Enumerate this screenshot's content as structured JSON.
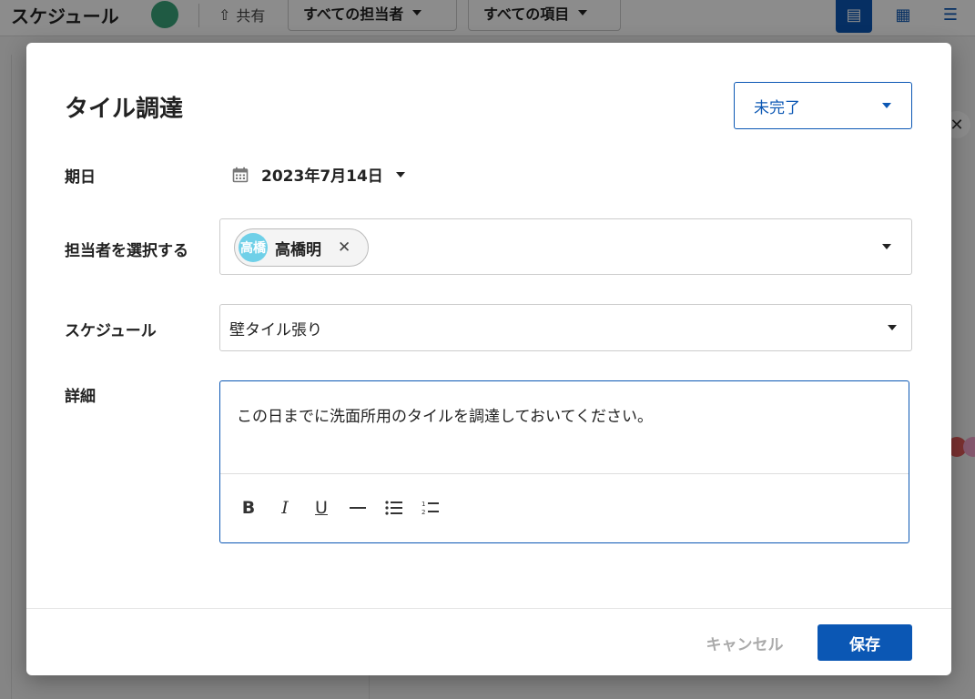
{
  "background": {
    "app_title": "スケジュール",
    "share_label": "共有",
    "assignee_filter": "すべての担当者",
    "item_filter": "すべての項目"
  },
  "modal": {
    "title": "タイル調達",
    "status": "未完了",
    "fields": {
      "date_label": "期日",
      "date_value": "2023年7月14日",
      "assignee_label": "担当者を選択する",
      "assignee_chip": {
        "avatar_text": "高橋",
        "name": "高橋明"
      },
      "schedule_label": "スケジュール",
      "schedule_value": "壁タイル張り",
      "details_label": "詳細",
      "details_value": "この日までに洗面所用のタイルを調達しておいてください。"
    },
    "toolbar": [
      "bold-icon",
      "italic-icon",
      "underline-icon",
      "horizontal-rule-icon",
      "bullet-list-icon",
      "numbered-list-icon"
    ],
    "footer": {
      "cancel_label": "キャンセル",
      "save_label": "保存"
    }
  },
  "colors": {
    "accent": "#0b57b4",
    "avatar": "#6fd0e8"
  }
}
